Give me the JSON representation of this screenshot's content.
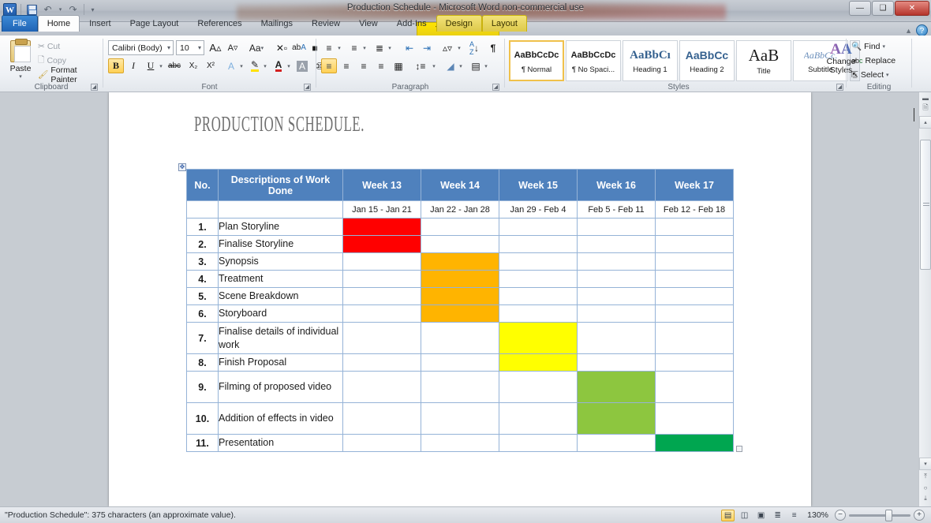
{
  "window": {
    "title": "Production Schedule  -  Microsoft Word non-commercial use",
    "minimize_label": "—",
    "maximize_label": "❑",
    "close_label": "✕",
    "app_logo_text": "W",
    "help_label": "?",
    "collapse_ribbon_label": "▲"
  },
  "quick_access": [
    {
      "name": "save-icon",
      "label": ""
    },
    {
      "name": "undo-icon",
      "label": "↶"
    },
    {
      "name": "undo-dropdown-icon",
      "label": "▾"
    },
    {
      "name": "redo-icon",
      "label": "↷"
    },
    {
      "name": "customize-qat-icon",
      "label": "▾"
    }
  ],
  "ribbon": {
    "tabs": [
      {
        "label": "File",
        "id": "file",
        "active": false
      },
      {
        "label": "Home",
        "id": "home",
        "active": true
      },
      {
        "label": "Insert",
        "id": "insert",
        "active": false
      },
      {
        "label": "Page Layout",
        "id": "page-layout",
        "active": false
      },
      {
        "label": "References",
        "id": "references",
        "active": false
      },
      {
        "label": "Mailings",
        "id": "mailings",
        "active": false
      },
      {
        "label": "Review",
        "id": "review",
        "active": false
      },
      {
        "label": "View",
        "id": "view",
        "active": false
      },
      {
        "label": "Add-Ins",
        "id": "add-ins",
        "active": false
      }
    ],
    "contextual": {
      "band_label": "Table Tools",
      "tabs": [
        {
          "label": "Design"
        },
        {
          "label": "Layout"
        }
      ]
    },
    "groups": {
      "clipboard": {
        "label": "Clipboard",
        "paste": "Paste",
        "paste_arrow": "▾",
        "cut": "Cut",
        "copy": "Copy",
        "format_painter": "Format Painter"
      },
      "font": {
        "label": "Font",
        "font_name": "Calibri (Body)",
        "font_size": "10",
        "grow_font": "A",
        "shrink_font": "A",
        "change_case": "Aa",
        "clear_formatting": "⌫",
        "bold": "B",
        "italic": "I",
        "underline": "U",
        "strikethrough": "abc",
        "subscript": "X₂",
        "superscript": "X²",
        "text_effects": "A",
        "highlight": "ab",
        "font_color": "A",
        "char_shading": "A",
        "char_border": "A",
        "phonetic": "文",
        "dropdown": "▾"
      },
      "paragraph": {
        "label": "Paragraph",
        "bullets": "☰",
        "numbering": "☰",
        "multilevel": "☰",
        "decrease_indent": "⇤",
        "increase_indent": "⇥",
        "sort": "↕",
        "show_marks": "¶",
        "align_left": "≡",
        "align_center": "≡",
        "align_right": "≡",
        "justify": "≡",
        "distributed": "≡",
        "line_spacing": "↕",
        "shading": "◢",
        "borders": "⊞",
        "dropdown": "▾"
      },
      "styles": {
        "label": "Styles",
        "items": [
          {
            "preview": "AaBbCcDc",
            "name": "¶ Normal",
            "selected": true
          },
          {
            "preview": "AaBbCcDc",
            "name": "¶ No Spaci...",
            "selected": false
          },
          {
            "preview": "AaBbCı",
            "name": "Heading 1",
            "selected": false
          },
          {
            "preview": "AaBbCc",
            "name": "Heading 2",
            "selected": false
          },
          {
            "preview": "AaB",
            "name": "Title",
            "selected": false
          },
          {
            "preview": "AaBbCc.",
            "name": "Subtitle",
            "selected": false
          }
        ],
        "change_styles": "Change",
        "change_styles_2": "Styles",
        "change_styles_arrow": "▾",
        "scroll_up": "▴",
        "scroll_down": "▾",
        "scroll_more": "☰"
      },
      "editing": {
        "label": "Editing",
        "find": "Find",
        "replace": "Replace",
        "select": "Select",
        "arrow": "▾"
      }
    }
  },
  "document": {
    "heading": "PRODUCTION SCHEDULE.",
    "table_move_handle": "✥",
    "table": {
      "headers": [
        "No.",
        "Descriptions of Work Done",
        "Week 13",
        "Week 14",
        "Week 15",
        "Week 16",
        "Week 17"
      ],
      "date_row": [
        "",
        "",
        "Jan 15 - Jan 21",
        "Jan 22 - Jan 28",
        "Jan 29 - Feb 4",
        "Feb 5 - Feb 11",
        "Feb 12 - Feb 18"
      ],
      "rows": [
        {
          "no": "1.",
          "task": "Plan Storyline",
          "fills": [
            "red",
            "",
            "",
            "",
            ""
          ],
          "tall": false
        },
        {
          "no": "2.",
          "task": "Finalise Storyline",
          "fills": [
            "red",
            "",
            "",
            "",
            ""
          ],
          "tall": false
        },
        {
          "no": "3.",
          "task": "Synopsis",
          "fills": [
            "",
            "orange",
            "",
            "",
            ""
          ],
          "tall": false
        },
        {
          "no": "4.",
          "task": "Treatment",
          "fills": [
            "",
            "orange",
            "",
            "",
            ""
          ],
          "tall": false
        },
        {
          "no": "5.",
          "task": "Scene Breakdown",
          "fills": [
            "",
            "orange",
            "",
            "",
            ""
          ],
          "tall": false
        },
        {
          "no": "6.",
          "task": "Storyboard",
          "fills": [
            "",
            "orange",
            "",
            "",
            ""
          ],
          "tall": false
        },
        {
          "no": "7.",
          "task": "Finalise details of individual work",
          "fills": [
            "",
            "",
            "yellow",
            "",
            ""
          ],
          "tall": true
        },
        {
          "no": "8.",
          "task": "Finish Proposal",
          "fills": [
            "",
            "",
            "yellow",
            "",
            ""
          ],
          "tall": false
        },
        {
          "no": "9.",
          "task": "Filming of proposed video",
          "fills": [
            "",
            "",
            "",
            "lgreen",
            ""
          ],
          "tall": true
        },
        {
          "no": "10.",
          "task": "Addition of effects in video",
          "fills": [
            "",
            "",
            "",
            "lgreen",
            ""
          ],
          "tall": true
        },
        {
          "no": "11.",
          "task": "Presentation",
          "fills": [
            "",
            "",
            "",
            "",
            "green"
          ],
          "tall": false
        }
      ]
    }
  },
  "colors": {
    "header_blue": "#4F81BD",
    "border_blue": "#95B3D7",
    "red": "#FF0000",
    "orange": "#FFB400",
    "yellow": "#FFFF00",
    "light_green": "#8DC63F",
    "green": "#00A650",
    "accent_yellow": "#FFD455"
  },
  "status_bar": {
    "text": "\"Production Schedule\": 375 characters (an approximate value).",
    "views": [
      {
        "name": "print-layout-view-icon",
        "glyph": "▤",
        "active": true
      },
      {
        "name": "full-screen-reading-view-icon",
        "glyph": "◫",
        "active": false
      },
      {
        "name": "web-layout-view-icon",
        "glyph": "▣",
        "active": false
      },
      {
        "name": "outline-view-icon",
        "glyph": "≣",
        "active": false
      },
      {
        "name": "draft-view-icon",
        "glyph": "≡",
        "active": false
      }
    ],
    "zoom_value": "130%",
    "zoom_out": "−",
    "zoom_in": "+"
  },
  "scrollbar": {
    "up": "▴",
    "down": "▾",
    "prev_page": "⤒",
    "select_object": "○",
    "next_page": "⤓",
    "split": "▬"
  }
}
